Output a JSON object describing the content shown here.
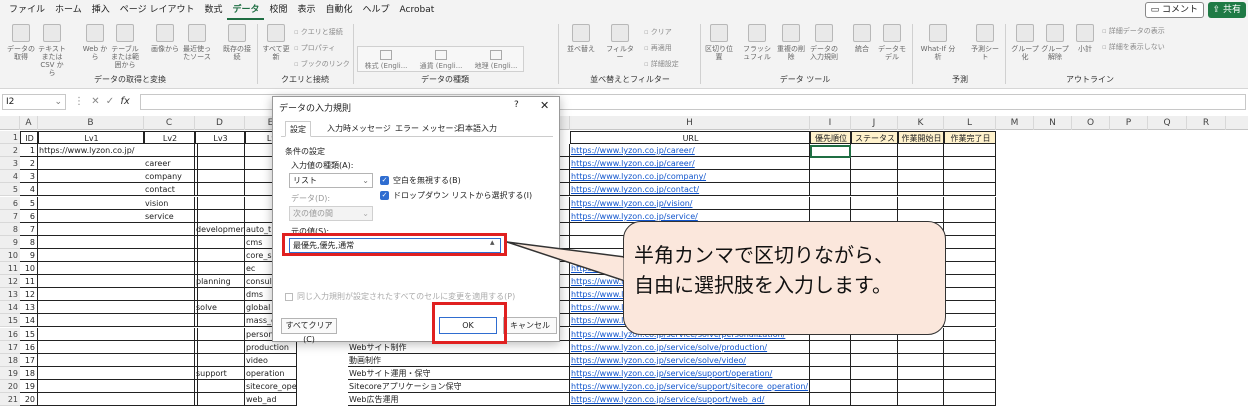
{
  "menu": {
    "tabs": [
      "ファイル",
      "ホーム",
      "挿入",
      "ページ レイアウト",
      "数式",
      "データ",
      "校閲",
      "表示",
      "自動化",
      "ヘルプ",
      "Acrobat"
    ],
    "active_tab": "データ",
    "comment_label": "コメント",
    "share_label": "共有"
  },
  "ribbon": {
    "buttons": [
      {
        "label": "データの取得"
      },
      {
        "label": "テキストまたはCSV から"
      },
      {
        "label": "Web から"
      },
      {
        "label": "テーブルまたは範囲から"
      },
      {
        "label": "画像から"
      },
      {
        "label": "最近使ったソース"
      },
      {
        "label": "既存の接続"
      },
      {
        "label": "すべて更新"
      },
      {
        "label": "株式 (Engli..."
      },
      {
        "label": "通貨 (Engli..."
      },
      {
        "label": "地理 (Engli..."
      },
      {
        "label": "並べ替え"
      },
      {
        "label": "フィルター"
      },
      {
        "label": "区切り位置"
      },
      {
        "label": "フラッシュフィル"
      },
      {
        "label": "重複の削除"
      },
      {
        "label": "データの入力規則"
      },
      {
        "label": "統合"
      },
      {
        "label": "データモデル"
      },
      {
        "label": "What-If 分析"
      },
      {
        "label": "予測シート"
      },
      {
        "label": "グループ化"
      },
      {
        "label": "グループ解除"
      },
      {
        "label": "小計"
      }
    ],
    "small_items": [
      "クエリと接続",
      "プロパティ",
      "ブックのリンク",
      "クリア",
      "再適用",
      "詳細設定",
      "詳細データの表示",
      "詳細を表示しない"
    ],
    "groups": [
      "データの取得と変換",
      "クエリと接続",
      "データの種類",
      "並べ替えとフィルター",
      "データ ツール",
      "予測",
      "アウトライン"
    ]
  },
  "formula_bar": {
    "name_box": "I2",
    "fx": "fx",
    "value": ""
  },
  "columns": [
    "A",
    "B",
    "C",
    "D",
    "E",
    "F",
    "G",
    "H",
    "I",
    "J",
    "K",
    "L",
    "M",
    "N",
    "O",
    "P",
    "Q",
    "R"
  ],
  "sheet": {
    "headers": {
      "id": "ID",
      "lv1": "Lv1",
      "lv2": "Lv2",
      "lv3": "Lv3",
      "lv4": "Lv",
      "url": "URL",
      "priority": "優先順位",
      "status": "ステータス",
      "start": "作業開始日",
      "end": "作業完了日"
    },
    "rows": [
      {
        "row": "2",
        "id": "1",
        "lv1": "https://www.lyzon.co.jp/",
        "lv2": "",
        "lv3": "",
        "lv4": "",
        "title": "",
        "url": "https://www.lyzon.co.jp/career/"
      },
      {
        "row": "3",
        "id": "2",
        "lv1": "",
        "lv2": "career",
        "lv3": "",
        "lv4": "",
        "title": "",
        "url": "https://www.lyzon.co.jp/career/"
      },
      {
        "row": "4",
        "id": "3",
        "lv1": "",
        "lv2": "company",
        "lv3": "",
        "lv4": "",
        "title": "",
        "url": "https://www.lyzon.co.jp/company/"
      },
      {
        "row": "5",
        "id": "4",
        "lv1": "",
        "lv2": "contact",
        "lv3": "",
        "lv4": "",
        "title": "",
        "url": "https://www.lyzon.co.jp/contact/"
      },
      {
        "row": "6",
        "id": "5",
        "lv1": "",
        "lv2": "vision",
        "lv3": "",
        "lv4": "",
        "title": "",
        "url": "https://www.lyzon.co.jp/vision/"
      },
      {
        "row": "7",
        "id": "6",
        "lv1": "",
        "lv2": "service",
        "lv3": "",
        "lv4": "",
        "title": "",
        "url": "https://www.lyzon.co.jp/service/"
      },
      {
        "row": "8",
        "id": "7",
        "lv1": "",
        "lv2": "",
        "lv3": "development",
        "lv4": "auto_t",
        "title": "",
        "url": ""
      },
      {
        "row": "9",
        "id": "8",
        "lv1": "",
        "lv2": "",
        "lv3": "",
        "lv4": "cms",
        "title": "",
        "url": ""
      },
      {
        "row": "10",
        "id": "9",
        "lv1": "",
        "lv2": "",
        "lv3": "",
        "lv4": "core_s",
        "title": "",
        "url": ""
      },
      {
        "row": "11",
        "id": "10",
        "lv1": "",
        "lv2": "",
        "lv3": "",
        "lv4": "ec",
        "title": "",
        "url": "https://www.lyzon.co.jp"
      },
      {
        "row": "12",
        "id": "11",
        "lv1": "",
        "lv2": "",
        "lv3": "planning",
        "lv4": "consul",
        "title": "",
        "url": "https://www.lyzon.co.jp"
      },
      {
        "row": "13",
        "id": "12",
        "lv1": "",
        "lv2": "",
        "lv3": "",
        "lv4": "dms",
        "title": "",
        "url": "https://www.lyzon.co.jp"
      },
      {
        "row": "14",
        "id": "13",
        "lv1": "",
        "lv2": "",
        "lv3": "solve",
        "lv4": "global",
        "title": "",
        "url": "https://www.lyzon.co.jp"
      },
      {
        "row": "15",
        "id": "14",
        "lv1": "",
        "lv2": "",
        "lv3": "",
        "lv4": "mass_c",
        "title": "",
        "url": "https://www.lyzon.co.jp"
      },
      {
        "row": "16",
        "id": "15",
        "lv1": "",
        "lv2": "",
        "lv3": "",
        "lv4": "persona",
        "title": "",
        "url": "https://www.lyzon.co.jp/service/solve/personalization/"
      },
      {
        "row": "17",
        "id": "16",
        "lv1": "",
        "lv2": "",
        "lv3": "",
        "lv4": "production",
        "title": "Webサイト制作",
        "url": "https://www.lyzon.co.jp/service/solve/production/"
      },
      {
        "row": "18",
        "id": "17",
        "lv1": "",
        "lv2": "",
        "lv3": "",
        "lv4": "video",
        "title": "動画制作",
        "url": "https://www.lyzon.co.jp/service/solve/video/"
      },
      {
        "row": "19",
        "id": "18",
        "lv1": "",
        "lv2": "",
        "lv3": "support",
        "lv4": "operation",
        "title": "Webサイト運用・保守",
        "url": "https://www.lyzon.co.jp/service/support/operation/"
      },
      {
        "row": "20",
        "id": "19",
        "lv1": "",
        "lv2": "",
        "lv3": "",
        "lv4": "sitecore_operation",
        "title": "Sitecoreアプリケーション保守",
        "url": "https://www.lyzon.co.jp/service/support/sitecore_operation/"
      },
      {
        "row": "21",
        "id": "20",
        "lv1": "",
        "lv2": "",
        "lv3": "",
        "lv4": "web_ad",
        "title": "Web広告運用",
        "url": "https://www.lyzon.co.jp/service/support/web_ad/"
      }
    ]
  },
  "dialog": {
    "title": "データの入力規則",
    "help": "?",
    "close": "✕",
    "tabs": [
      "設定",
      "入力時メッセージ",
      "エラー メッセージ",
      "日本語入力"
    ],
    "active_tab": "設定",
    "condition_legend": "条件の設定",
    "allow_label": "入力値の種類(A):",
    "allow_value": "リスト",
    "data_label": "データ(D):",
    "data_value": "次の値の間",
    "ignore_blank": "空白を無視する(B)",
    "dropdown": "ドロップダウン リストから選択する(I)",
    "source_label": "元の値(S):",
    "source_value": "最優先,優先,通常",
    "apply_all": "同じ入力規則が設定されたすべてのセルに変更を適用する(P)",
    "clear_all": "すべてクリア(C)",
    "ok": "OK",
    "cancel": "キャンセル"
  },
  "callout": {
    "line1": "半角カンマで区切りながら、",
    "line2": "自由に選択肢を入力します。"
  },
  "colors": {
    "accent": "#1f6e43",
    "highlight": "#e02020",
    "callout_fill": "#fbe7dc",
    "link": "#1155cc"
  }
}
